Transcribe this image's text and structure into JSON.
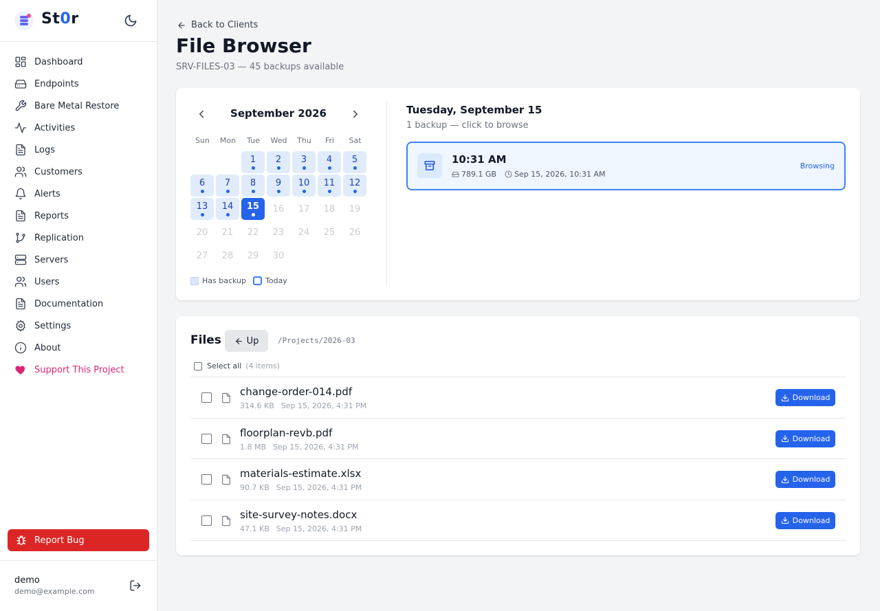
{
  "brand": {
    "name_prefix": "St",
    "name_zero": "0",
    "name_suffix": "r"
  },
  "nav": [
    {
      "label": "Dashboard",
      "icon": "dashboard-icon"
    },
    {
      "label": "Endpoints",
      "icon": "hard-drive-icon"
    },
    {
      "label": "Bare Metal Restore",
      "icon": "wrench-icon"
    },
    {
      "label": "Activities",
      "icon": "activity-icon"
    },
    {
      "label": "Logs",
      "icon": "file-text-icon"
    },
    {
      "label": "Customers",
      "icon": "users-icon"
    },
    {
      "label": "Alerts",
      "icon": "bell-icon"
    },
    {
      "label": "Reports",
      "icon": "file-text-icon"
    },
    {
      "label": "Replication",
      "icon": "git-branch-icon"
    },
    {
      "label": "Servers",
      "icon": "server-icon"
    },
    {
      "label": "Users",
      "icon": "users-icon"
    },
    {
      "label": "Documentation",
      "icon": "file-text-icon"
    },
    {
      "label": "Settings",
      "icon": "gear-icon"
    },
    {
      "label": "About",
      "icon": "info-icon"
    },
    {
      "label": "Support This Project",
      "icon": "heart-icon"
    }
  ],
  "report_bug": "Report Bug",
  "user": {
    "name": "demo",
    "email": "demo@example.com"
  },
  "header": {
    "back_label": "Back to Clients",
    "title": "File Browser",
    "subtitle": "SRV-FILES-03 — 45 backups available"
  },
  "calendar": {
    "month_label": "September 2026",
    "weekdays": [
      "Sun",
      "Mon",
      "Tue",
      "Wed",
      "Thu",
      "Fri",
      "Sat"
    ],
    "first_weekday_index": 2,
    "days_in_month": 30,
    "backup_days": [
      1,
      2,
      3,
      4,
      5,
      6,
      7,
      8,
      9,
      10,
      11,
      12,
      13,
      14,
      15
    ],
    "selected_day": 15,
    "legend_has_backup": "Has backup",
    "legend_today": "Today"
  },
  "selected_day": {
    "title": "Tuesday, September 15",
    "subtitle": "1 backup — click to browse",
    "backup": {
      "time": "10:31 AM",
      "size": "789.1 GB",
      "datetime": "Sep 15, 2026, 10:31 AM",
      "status": "Browsing"
    }
  },
  "files": {
    "title": "Files",
    "up_label": "Up",
    "path": "/Projects/2026-03",
    "select_all_label": "Select all",
    "count_label": "(4 items)",
    "download_label": "Download",
    "items": [
      {
        "name": "change-order-014.pdf",
        "size": "314.6 KB",
        "date": "Sep 15, 2026, 4:31 PM"
      },
      {
        "name": "floorplan-revb.pdf",
        "size": "1.8 MB",
        "date": "Sep 15, 2026, 4:31 PM"
      },
      {
        "name": "materials-estimate.xlsx",
        "size": "90.7 KB",
        "date": "Sep 15, 2026, 4:31 PM"
      },
      {
        "name": "site-survey-notes.docx",
        "size": "47.1 KB",
        "date": "Sep 15, 2026, 4:31 PM"
      }
    ]
  },
  "colors": {
    "accent": "#2563eb",
    "danger": "#dc2626",
    "support": "#db2777"
  }
}
